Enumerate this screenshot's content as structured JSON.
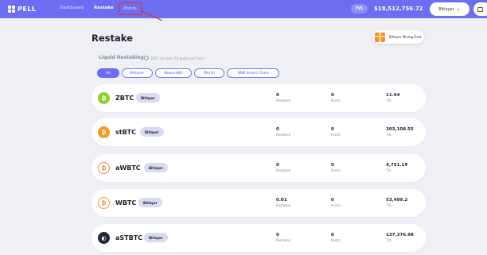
{
  "header": {
    "logo_text": "PELL",
    "nav": [
      {
        "label": "Dashboard"
      },
      {
        "label": "Restake"
      },
      {
        "label": "Points"
      }
    ],
    "tvl_label": "TVL",
    "tvl_value": "$18,512,756.72",
    "chain_select": "Bitlayer",
    "wallet_icon": "wallet-icon"
  },
  "main": {
    "title": "Restake",
    "mining_button": "Bitlayer Mining Gala",
    "section_label": "Liquid Restaking",
    "section_note": "1BTC can earn 10 points per hour",
    "filters": [
      {
        "label": "All",
        "active": true
      },
      {
        "label": "Bitlayer",
        "active": false
      },
      {
        "label": "BounceBit",
        "active": false
      },
      {
        "label": "Merlin",
        "active": false
      },
      {
        "label": "BNB Smart Chain",
        "active": false
      }
    ],
    "metric_labels": {
      "restaked": "Restaked",
      "points": "Points",
      "tvl": "TVL"
    },
    "assets": [
      {
        "name": "ZBTC",
        "chain": "Bitlayer",
        "restaked": "0",
        "points": "0",
        "tvl": "11.64",
        "icon_color": "#8fd12b",
        "glyph": "₿"
      },
      {
        "name": "stBTC",
        "chain": "Bitlayer",
        "restaked": "0",
        "points": "0",
        "tvl": "303,108.55",
        "icon_color": "#f39a2b",
        "glyph": "₿"
      },
      {
        "name": "aWBTC",
        "chain": "Bitlayer",
        "restaked": "0",
        "points": "0",
        "tvl": "4,751.19",
        "icon_color": "#e8863a",
        "glyph": "₿"
      },
      {
        "name": "WBTC",
        "chain": "Bitlayer",
        "restaked": "0.01",
        "points": "0",
        "tvl": "53,499.2",
        "icon_color": "#f0922e",
        "glyph": "₿"
      },
      {
        "name": "aSTBTC",
        "chain": "Bitlayer",
        "restaked": "0",
        "points": "0",
        "tvl": "137,376.98",
        "icon_color": "#1e2a3a",
        "glyph": "◐"
      }
    ]
  }
}
